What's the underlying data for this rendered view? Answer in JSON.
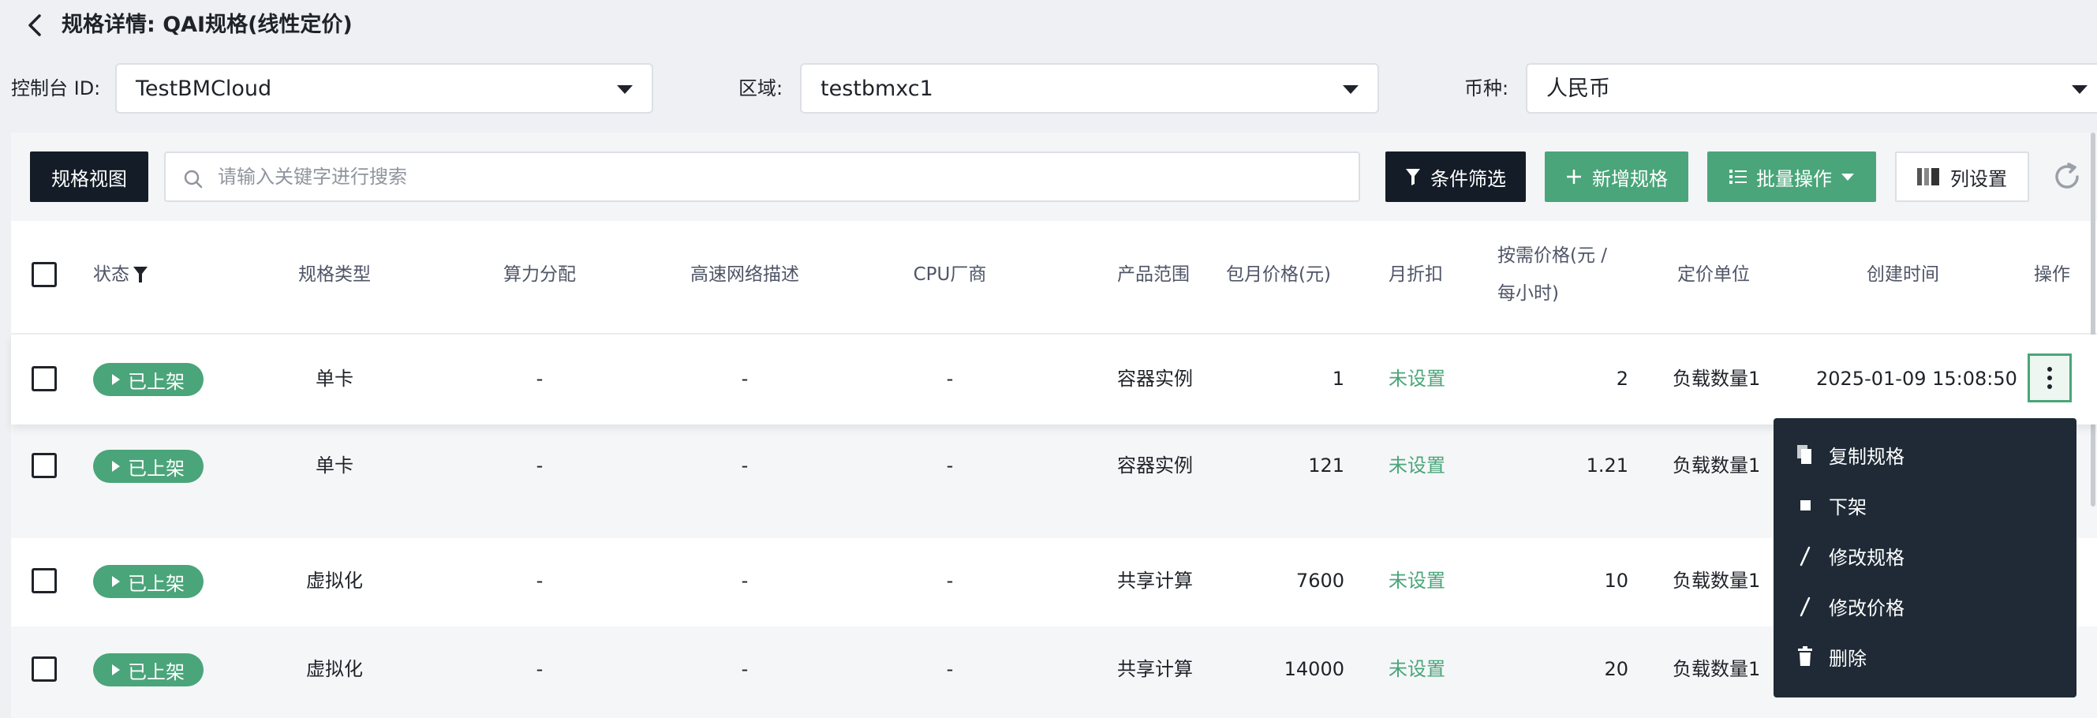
{
  "header": {
    "title": "规格详情: QAI规格(线性定价)"
  },
  "filters": {
    "console": {
      "label": "控制台 ID:",
      "value": "TestBMCloud"
    },
    "region": {
      "label": "区域:",
      "value": "testbmxc1"
    },
    "currency": {
      "label": "币种:",
      "value": "人民币"
    }
  },
  "toolbar": {
    "view_label": "规格视图",
    "search_placeholder": "请输入关键字进行搜索",
    "filter_label": "条件筛选",
    "add_label": "新增规格",
    "batch_label": "批量操作",
    "columns_label": "列设置"
  },
  "columns": {
    "status": "状态",
    "spec_type": "规格类型",
    "compute": "算力分配",
    "network": "高速网络描述",
    "cpu_vendor": "CPU厂商",
    "product_range": "产品范围",
    "monthly_price": "包月价格(元)",
    "monthly_discount": "月折扣",
    "ondemand_price_1": "按需价格(元 /",
    "ondemand_price_2": "每小时)",
    "pricing_unit": "定价单位",
    "created_at": "创建时间",
    "actions": "操作"
  },
  "rows": [
    {
      "status": "已上架",
      "spec_type": "单卡",
      "compute": "-",
      "network": "-",
      "cpu_vendor": "-",
      "product_range": "容器实例",
      "monthly_price": "1",
      "monthly_discount": "未设置",
      "ondemand_price": "2",
      "pricing_unit": "负载数量1",
      "created_at": "2025-01-09 15:08:50"
    },
    {
      "status": "已上架",
      "spec_type": "单卡",
      "compute": "-",
      "network": "-",
      "cpu_vendor": "-",
      "product_range": "容器实例",
      "monthly_price": "121",
      "monthly_discount": "未设置",
      "ondemand_price": "1.21",
      "pricing_unit": "负载数量1"
    },
    {
      "status": "已上架",
      "spec_type": "虚拟化",
      "compute": "-",
      "network": "-",
      "cpu_vendor": "-",
      "product_range": "共享计算",
      "monthly_price": "7600",
      "monthly_discount": "未设置",
      "ondemand_price": "10",
      "pricing_unit": "负载数量1"
    },
    {
      "status": "已上架",
      "spec_type": "虚拟化",
      "compute": "-",
      "network": "-",
      "cpu_vendor": "-",
      "product_range": "共享计算",
      "monthly_price": "14000",
      "monthly_discount": "未设置",
      "ondemand_price": "20",
      "pricing_unit": "负载数量1"
    }
  ],
  "menu": {
    "items": [
      {
        "label": "复制规格",
        "icon": "copy-icon"
      },
      {
        "label": "下架",
        "icon": "stop-icon"
      },
      {
        "label": "修改规格",
        "icon": "edit-icon"
      },
      {
        "label": "修改价格",
        "icon": "edit-icon"
      },
      {
        "label": "删除",
        "icon": "trash-icon"
      }
    ]
  },
  "colors": {
    "accent_green": "#4aa57a",
    "dark": "#141d27",
    "menu_bg": "#1f2a36"
  }
}
